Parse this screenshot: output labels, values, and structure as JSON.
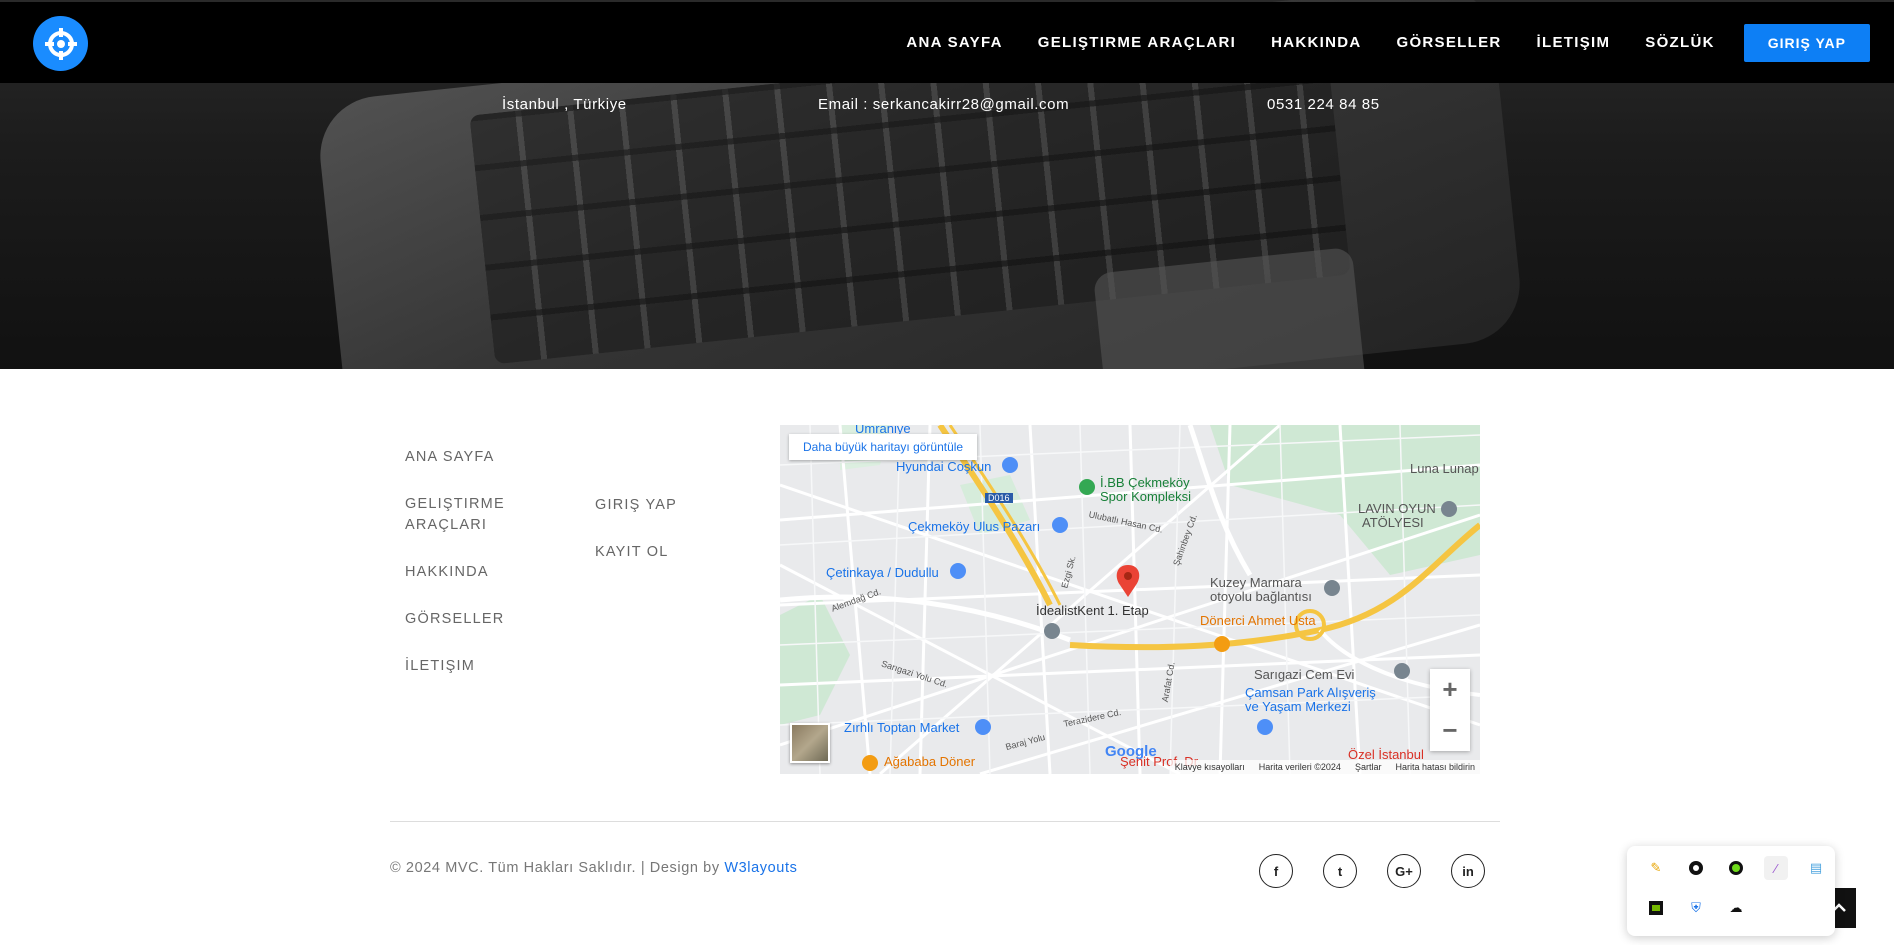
{
  "nav": {
    "items": [
      "ANA SAYFA",
      "GELIŞTIRME ARAÇLARI",
      "HAKKINDA",
      "GÖRSELLER",
      "İLETIŞIM",
      "SÖZLÜK"
    ],
    "login": "GIRIŞ YAP"
  },
  "contact": {
    "location": "İstanbul , Türkiye",
    "email": "Email : serkancakirr28@gmail.com",
    "phone": "0531 224 84 85"
  },
  "footer": {
    "links1": [
      "ANA SAYFA",
      "GELIŞTIRME ARAÇLARI",
      "HAKKINDA",
      "GÖRSELLER",
      "İLETIŞIM"
    ],
    "links2": [
      "GIRIŞ YAP",
      "KAYIT OL"
    ],
    "copyright": "© 2024 MVC. Tüm Hakları Saklıdır. | Design by ",
    "design_link": "W3layouts"
  },
  "map": {
    "larger_map_link": "Daha büyük haritayı görüntüle",
    "zoom_in": "+",
    "zoom_out": "−",
    "google": "Google",
    "attribution": [
      "Klavye kısayolları",
      "Harita verileri ©2024",
      "Şartlar",
      "Harita hatası bildirin"
    ],
    "labels": {
      "umraniye": "Ümraniye",
      "hyundai": "Hyundai Coşkun",
      "ibb": "İ.BB Çekmeköy",
      "ibb2": "Spor Kompleksi",
      "ulus": "Çekmeköy Ulus Pazarı",
      "cetinkaya": "Çetinkaya / Dudullu",
      "idealist": "İdealistKent 1. Etap",
      "kuzey": "Kuzey Marmara",
      "kuzey2": "otoyolu bağlantısı",
      "lavin": "LAVIN OYUN",
      "lavin2": "ATÖLYESI",
      "luna": "Luna Lunap",
      "donerci": "Dönerci Ahmet Usta",
      "sarigazi": "Sarıgazi Cem Evi",
      "camsan": "Çamsan Park Alışveriş",
      "camsan2": "ve Yaşam Merkezi",
      "zirhli": "Zırhlı Toptan Market",
      "agababa": "Ağababa Döner",
      "ozel": "Özel İstanbul",
      "sehit": "Şehit Prof. Dr.",
      "road_d016": "D016",
      "road_alemdag": "Alemdağ Cd.",
      "road_sarigazi": "Sarıgazi Yolu Cd.",
      "road_baraj": "Baraj Yolu",
      "road_terazidere": "Terazidere Cd.",
      "road_ulubatli": "Ulubatlı Hasan Cd.",
      "road_sahinbey": "Şahinbey Cd.",
      "road_ezgi": "Ezgi Sk.",
      "road_arafat": "Arafat Cd."
    }
  },
  "social": [
    "f",
    "t",
    "G+",
    "in"
  ],
  "colors": {
    "accent": "#0d7ff5",
    "nav_bg": "#000000"
  }
}
